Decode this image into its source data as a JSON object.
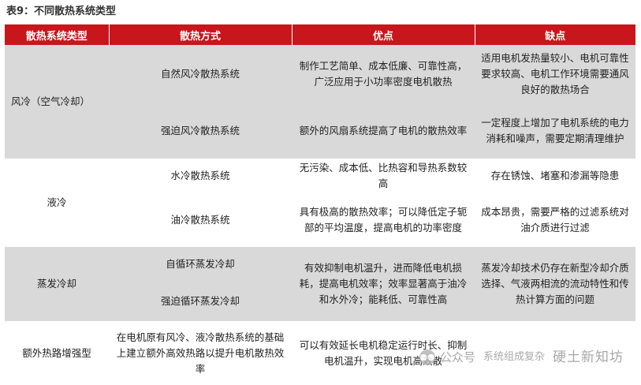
{
  "title": "表9：不同散热系统类型",
  "headers": [
    "散热系统类型",
    "散热方式",
    "优点",
    "缺点"
  ],
  "groups": {
    "air": {
      "type": "风冷（空气冷却）",
      "methods": [
        "自然风冷散热系统",
        "强迫风冷散热系统"
      ],
      "pros": [
        "制作工艺简单、成本低廉、可靠性高，广泛应用于小功率密度电机散热",
        "额外的风扇系统提高了电机的散热效率"
      ],
      "cons": [
        "适用电机发热量较小、电机可靠性要求较高、电机工作环境需要通风良好的散热场合",
        "一定程度上增加了电机系统的电力消耗和噪声，需要定期清理维护"
      ]
    },
    "liquid": {
      "type": "液冷",
      "methods": [
        "水冷散热系统",
        "油冷散热系统"
      ],
      "pros": [
        "无污染、成本低、比热容和导热系数较高",
        "具有极高的散热效率；可以降低定子轭部的平均温度，提高电机的功率密度"
      ],
      "cons": [
        "存在锈蚀、堵塞和渗漏等隐患",
        "成本昂贵，需要严格的过滤系统对油介质进行过滤"
      ]
    },
    "evap": {
      "type": "蒸发冷却",
      "methods": [
        "自循环蒸发冷却",
        "强迫循环蒸发冷却"
      ],
      "pros": "有效抑制电机温升，进而降低电机损耗，提高电机效率；效率显著高于油冷和水外冷；能耗低、可靠性高",
      "cons": "蒸发冷却技术仍存在新型冷却介质选择、气液两相流的流动特性和传热计算方面的问题"
    },
    "extra": {
      "type": "额外热路增强型",
      "method": "在电机原有风冷、液冷散热系统的基础上建立额外高效热路以提升电机散热效率",
      "pros": "可以有效延长电机稳定运行时长、抑制电机温升，实现电机高效散",
      "cons": "系统组成复杂"
    }
  },
  "watermark": {
    "icon": "wechat-icon",
    "label": "公众号",
    "name": "系统组成复杂",
    "brand": "硬土新知坊"
  }
}
